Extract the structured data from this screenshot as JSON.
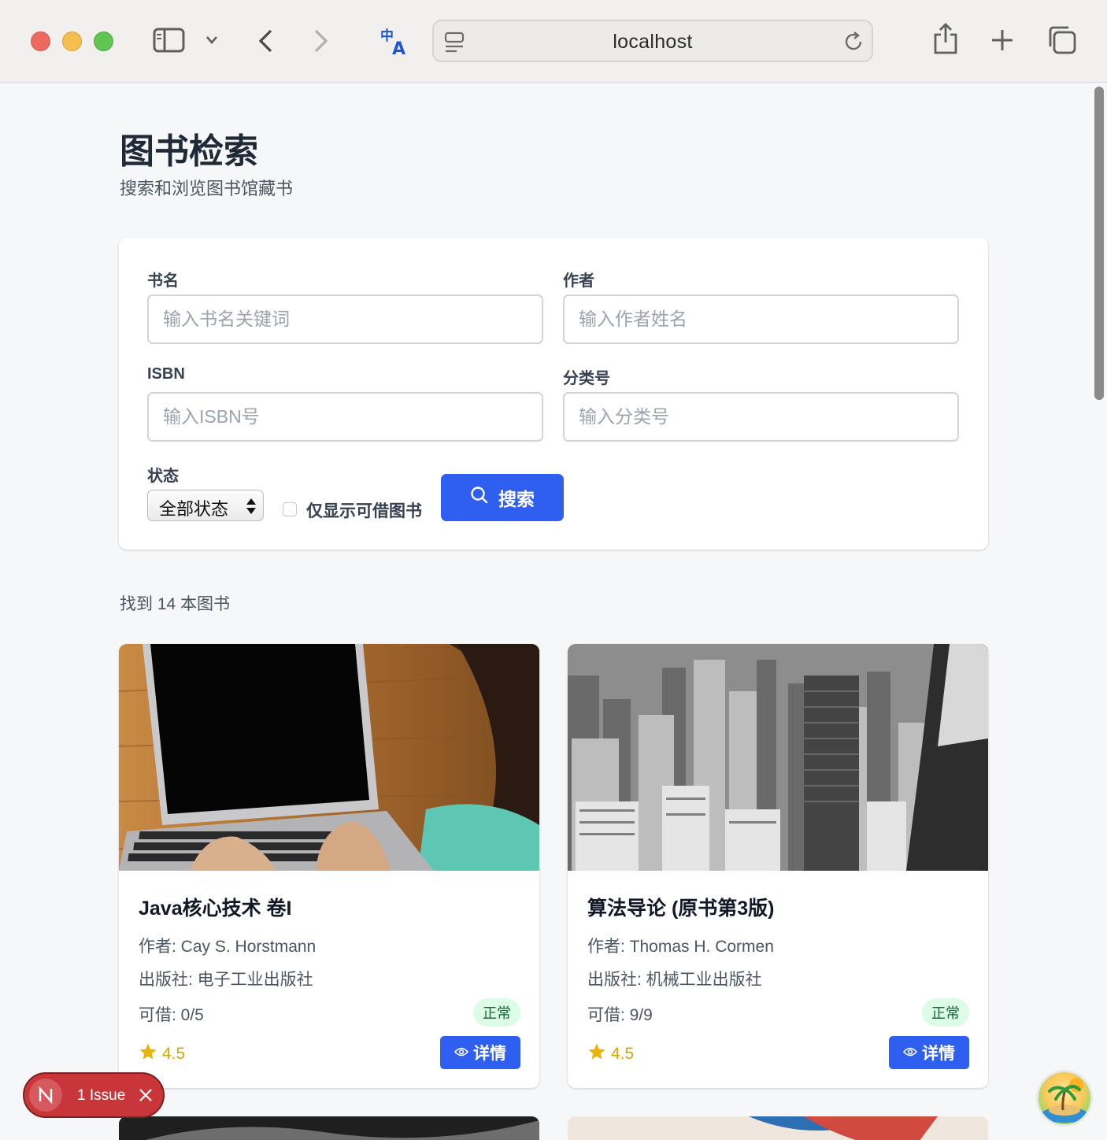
{
  "browser": {
    "url": "localhost"
  },
  "page": {
    "title": "图书检索",
    "subtitle": "搜索和浏览图书馆藏书"
  },
  "form": {
    "title_label": "书名",
    "title_placeholder": "输入书名关键词",
    "author_label": "作者",
    "author_placeholder": "输入作者姓名",
    "isbn_label": "ISBN",
    "isbn_placeholder": "输入ISBN号",
    "class_label": "分类号",
    "class_placeholder": "输入分类号",
    "status_label": "状态",
    "status_selected": "全部状态",
    "available_only_label": "仅显示可借图书",
    "available_only_checked": false,
    "search_button": "搜索"
  },
  "results": {
    "count_text": "找到 14 本图书",
    "books": [
      {
        "title": "Java核心技术 卷I",
        "author": "作者: Cay S. Horstmann",
        "publisher": "出版社: 电子工业出版社",
        "available": "可借: 0/5",
        "status": "正常",
        "rating": "4.5",
        "detail_button": "详情",
        "image_icon": "laptop-photo"
      },
      {
        "title": "算法导论 (原书第3版)",
        "author": "作者: Thomas H. Cormen",
        "publisher": "出版社: 机械工业出版社",
        "available": "可借: 9/9",
        "status": "正常",
        "rating": "4.5",
        "detail_button": "详情",
        "image_icon": "city-photo"
      }
    ]
  },
  "overlay": {
    "issue_text": "1 Issue"
  },
  "colors": {
    "primary": "#2f5ff0",
    "badge_bg": "#dcfce7",
    "badge_text": "#166534",
    "rating": "#d9a406",
    "issue_bg": "#c9363a"
  }
}
